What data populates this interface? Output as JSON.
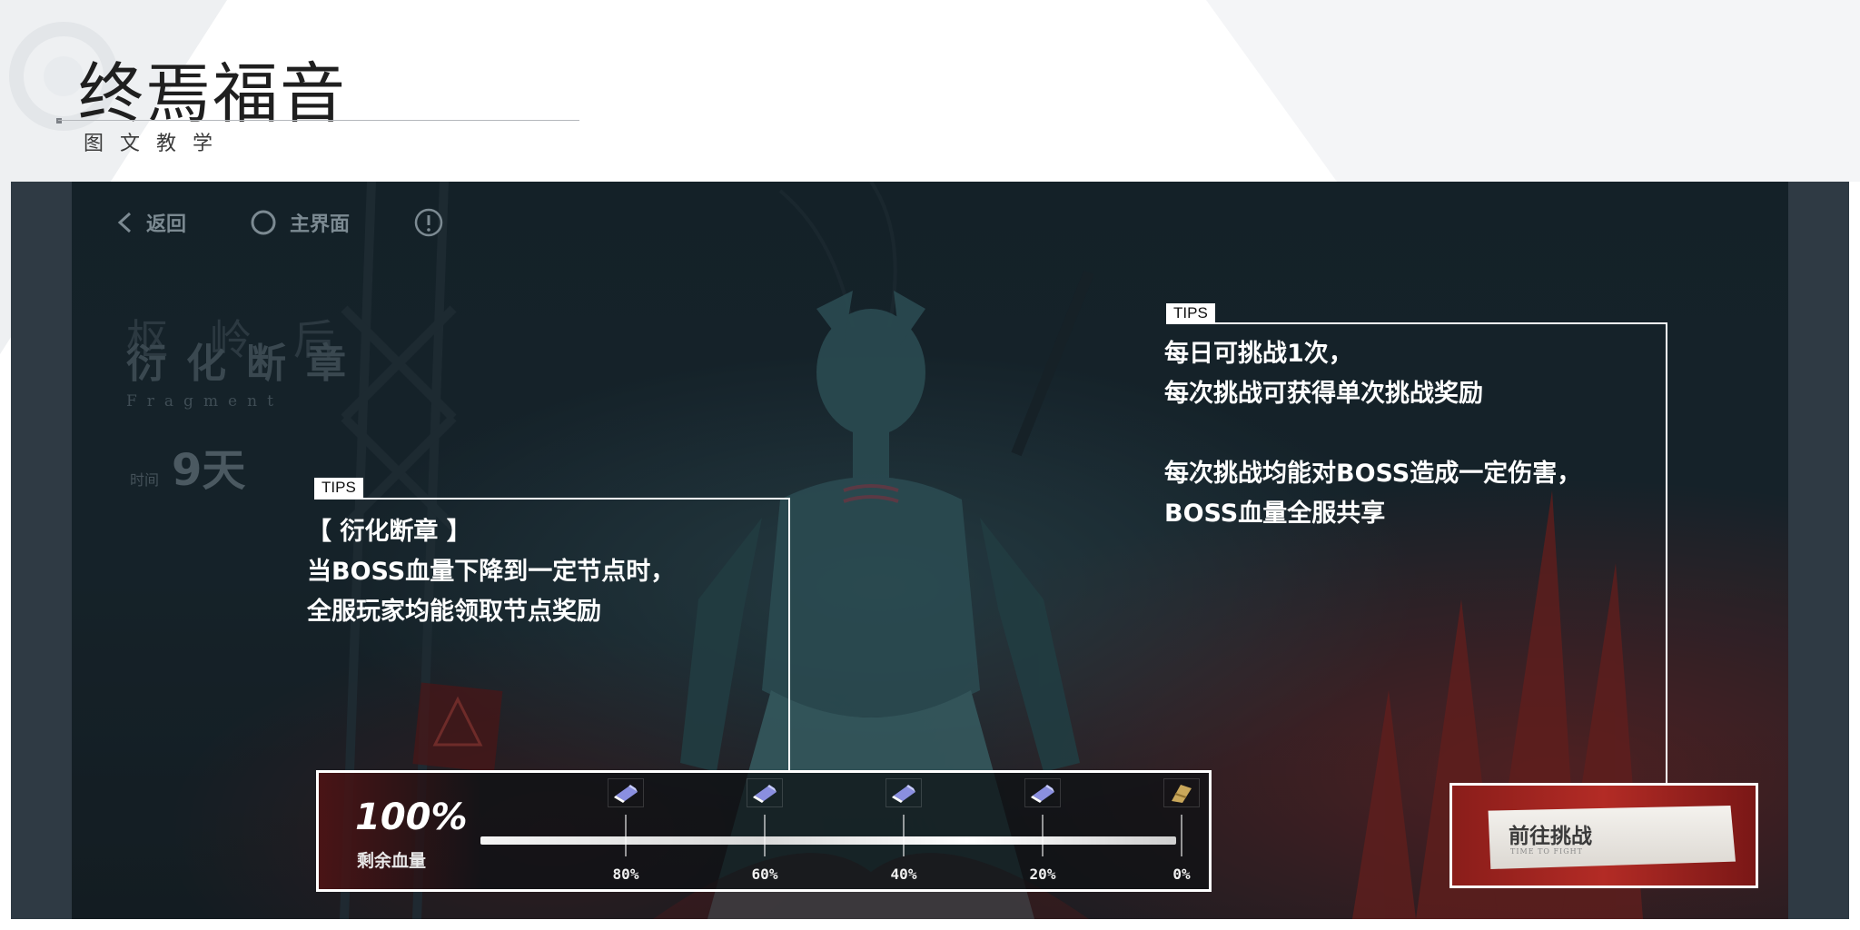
{
  "header": {
    "title": "终焉福音",
    "subtitle": "图文教学"
  },
  "nav": {
    "back_label": "返回",
    "home_label": "主界面"
  },
  "event": {
    "ghost_text": "枢岭后",
    "name": "衍化断章",
    "name_en": "Fragment",
    "time_label": "时间",
    "time_value": "9天"
  },
  "tips_left": {
    "tag": "TIPS",
    "text": "【 衍化断章 】\n当BOSS血量下降到一定节点时，\n全服玩家均能领取节点奖励"
  },
  "tips_right": {
    "tag": "TIPS",
    "text": "每日可挑战1次，\n每次挑战可获得单次挑战奖励\n\n每次挑战均能对BOSS造成一定伤害，\nBOSS血量全服共享"
  },
  "hp": {
    "value": "100%",
    "label": "剩余血量",
    "remaining_fraction": 1.0,
    "nodes": [
      {
        "pct": "80%",
        "icon": "crystal-reward-icon"
      },
      {
        "pct": "60%",
        "icon": "crystal-reward-icon"
      },
      {
        "pct": "40%",
        "icon": "crystal-reward-icon"
      },
      {
        "pct": "20%",
        "icon": "crystal-reward-icon"
      },
      {
        "pct": "0%",
        "icon": "gold-reward-icon"
      }
    ]
  },
  "challenge": {
    "label": "前往挑战",
    "label_en": "TIME TO FIGHT"
  },
  "colors": {
    "scene_bg": "#1b2a32",
    "accent_red": "#b32b25",
    "tip_text": "#ffffff"
  }
}
